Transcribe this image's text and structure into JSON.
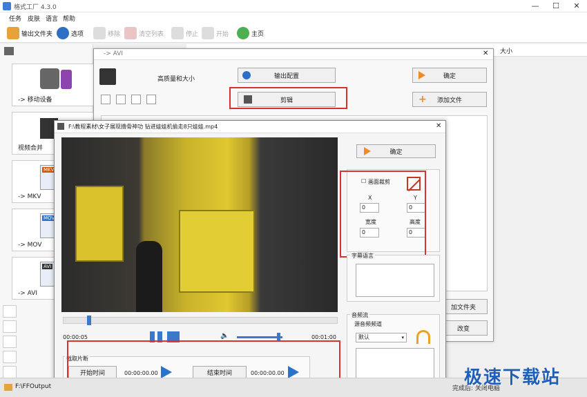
{
  "window": {
    "title": "格式工厂 4.3.0",
    "minimize": "—",
    "maximize": "☐",
    "close": "✕"
  },
  "menu": [
    "任务",
    "皮肤",
    "语言",
    "帮助"
  ],
  "toolbar": {
    "output_folder": "输出文件夹",
    "options": "选项",
    "remove": "移除",
    "clear_list": "清空列表",
    "stop": "停止",
    "start": "开始",
    "home": "主页"
  },
  "list_header": {
    "size": "大小"
  },
  "sidebar": {
    "categories": [
      {
        "label": "-> 移动设备"
      },
      {
        "label": "视频合并"
      },
      {
        "label": "-> MKV",
        "badge": "MKV"
      },
      {
        "label": "-> MOV",
        "badge": "MOV"
      },
      {
        "label": "-> AVI",
        "badge": "AVI"
      }
    ],
    "output_path": "F:\\FFOutput"
  },
  "avi_dialog": {
    "title": "-> AVI",
    "quality": "高质量和大小",
    "output_config": "输出配置",
    "ok": "确定",
    "clip": "剪辑",
    "add_file": "添加文件",
    "add_folder": "加文件夹",
    "change": "改变"
  },
  "cut_dialog": {
    "title": "F:\\教程素材\\女子展现撸骨神功 钻进娃娃机偷走8只娃娃.mp4",
    "ok": "确定",
    "crop": {
      "label": "画面裁剪",
      "x_label": "X",
      "x_value": "0",
      "y_label": "Y",
      "y_value": "0",
      "w_label": "宽度",
      "w_value": "0",
      "h_label": "高度",
      "h_value": "0"
    },
    "subtitle_label": "字幕语言",
    "audio": {
      "group_label": "音频流",
      "channel_label": "源音频频道",
      "channel_value": "默认"
    },
    "time_start": "00:00:05",
    "time_end": "00:01:00",
    "clip_section": {
      "label": "截取片断",
      "start_button": "开始时间",
      "start_value": "00:00:00.00",
      "end_button": "结束时间",
      "end_value": "00:00:00.00"
    }
  },
  "status": {
    "right_text": "完成后: 关闭电脑"
  },
  "watermark": "极速下载站"
}
